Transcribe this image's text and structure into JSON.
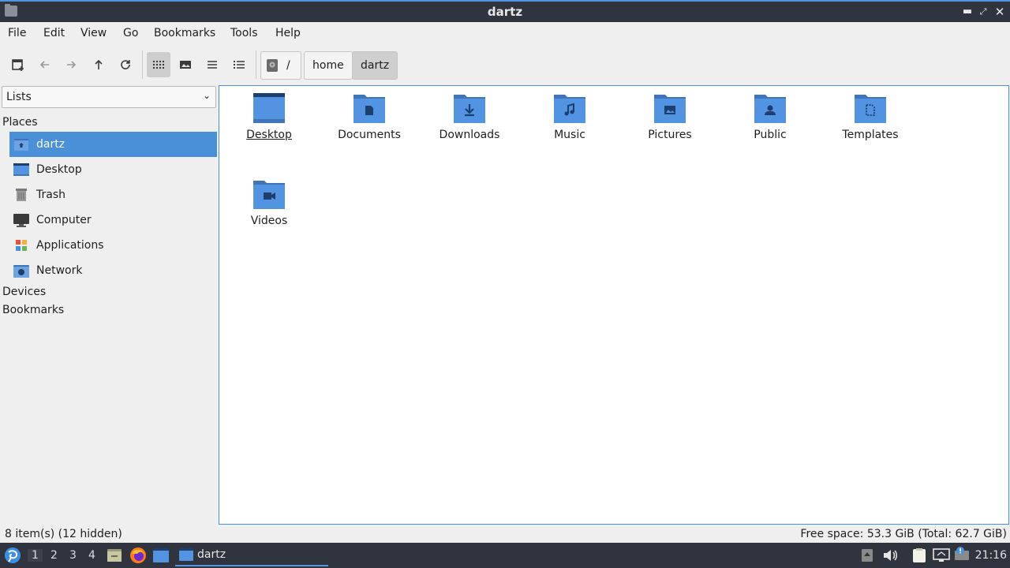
{
  "window": {
    "title": "dartz"
  },
  "menu": [
    "File",
    "Edit",
    "View",
    "Go",
    "Bookmarks",
    "Tools",
    "Help"
  ],
  "toolbar": {
    "buttons": [
      "new-tab-icon",
      "back-icon",
      "forward-icon",
      "up-icon",
      "reload-icon",
      "icon-view-icon",
      "thumbnail-view-icon",
      "compact-view-icon",
      "detailed-list-icon"
    ],
    "breadcrumb": {
      "root": "/",
      "parts": [
        "home",
        "dartz"
      ]
    }
  },
  "sidepane": {
    "mode": "Lists",
    "places_label": "Places",
    "places": [
      {
        "label": "dartz",
        "icon": "home-folder-icon",
        "selected": true
      },
      {
        "label": "Desktop",
        "icon": "desktop-icon"
      },
      {
        "label": "Trash",
        "icon": "trash-icon"
      },
      {
        "label": "Computer",
        "icon": "computer-icon"
      },
      {
        "label": "Applications",
        "icon": "applications-icon"
      },
      {
        "label": "Network",
        "icon": "network-icon"
      }
    ],
    "devices_label": "Devices",
    "bookmarks_label": "Bookmarks"
  },
  "files": [
    {
      "name": "Desktop",
      "icon": "desktop-folder-icon"
    },
    {
      "name": "Documents",
      "icon": "documents-folder-icon"
    },
    {
      "name": "Downloads",
      "icon": "downloads-folder-icon"
    },
    {
      "name": "Music",
      "icon": "music-folder-icon"
    },
    {
      "name": "Pictures",
      "icon": "pictures-folder-icon"
    },
    {
      "name": "Public",
      "icon": "public-folder-icon"
    },
    {
      "name": "Templates",
      "icon": "templates-folder-icon"
    },
    {
      "name": "Videos",
      "icon": "videos-folder-icon"
    }
  ],
  "status": {
    "items": "8 item(s) (12 hidden)",
    "free_space": "Free space: 53.3 GiB (Total: 62.7 GiB)"
  },
  "panel": {
    "workspaces": [
      "1",
      "2",
      "3",
      "4"
    ],
    "active_task": "dartz",
    "clock": "21:16"
  },
  "colors": {
    "accent": "#4a90d9",
    "folder": "#5294e2",
    "panel": "#2f343f"
  }
}
